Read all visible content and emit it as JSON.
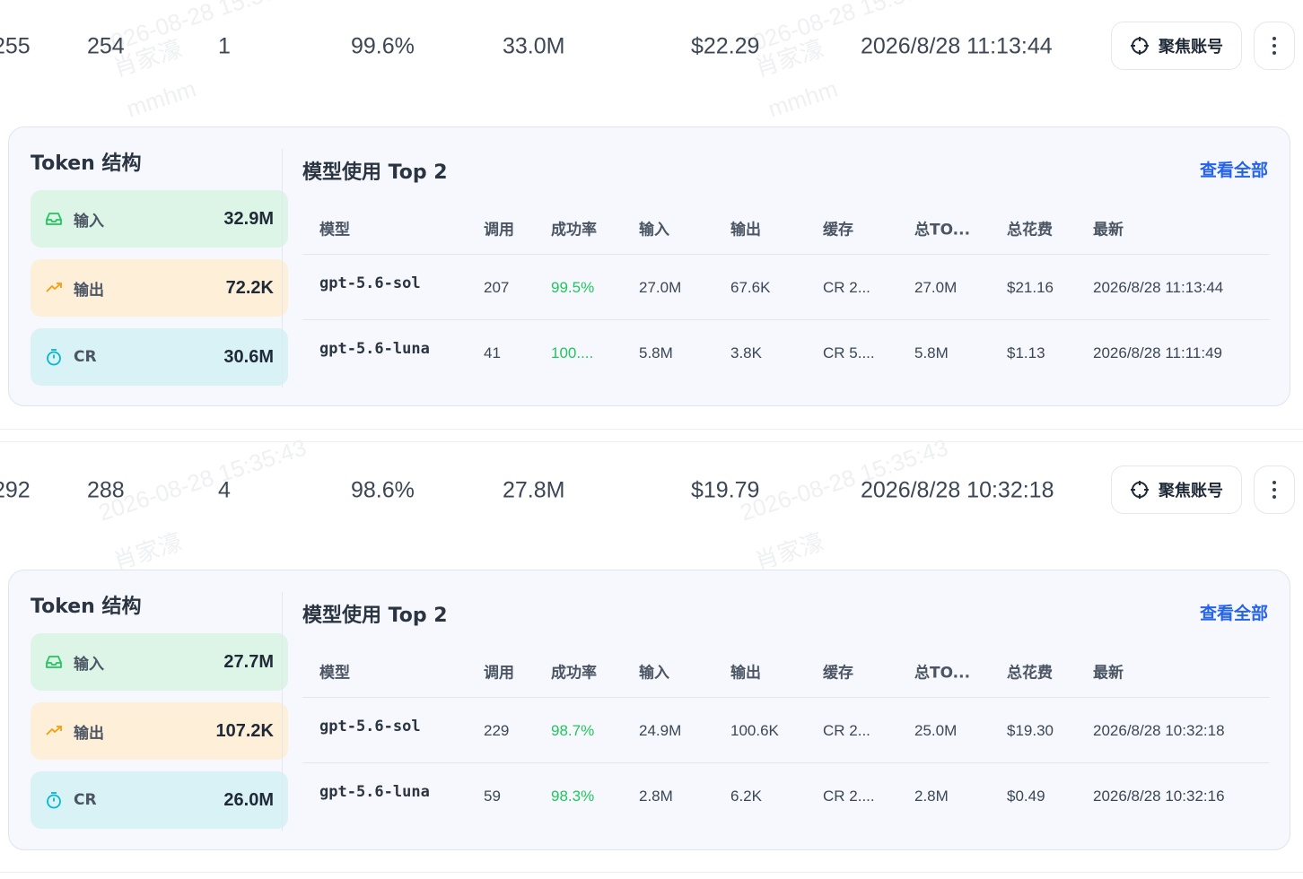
{
  "watermark": {
    "date": "2026-08-28 15:35:43",
    "name": "肖家濠",
    "user": "mmhm"
  },
  "colors": {
    "accent": "#2563eb",
    "success": "#22c55e",
    "input_bg": "#dcf5e6",
    "output_bg": "#fdefd8",
    "cr_bg": "#d9f2f6"
  },
  "labels": {
    "focus": "聚焦账号",
    "token_title": "Token 结构",
    "input": "输入",
    "output": "输出",
    "cr": "CR",
    "top_title": "模型使用 Top 2",
    "view_all": "查看全部",
    "columns": [
      "模型",
      "调用",
      "成功率",
      "输入",
      "输出",
      "缓存",
      "总TO...",
      "总花费",
      "最新"
    ]
  },
  "rows": [
    {
      "summary": {
        "total": "255",
        "success": "254",
        "failed": "1",
        "rate": "99.6%",
        "tokens": "33.0M",
        "cost": "$22.29",
        "latest": "2026/8/28 11:13:44"
      },
      "tokens": {
        "input": "32.9M",
        "output": "72.2K",
        "cr": "30.6M"
      },
      "models": [
        {
          "name": "gpt-5.6-sol",
          "calls": "207",
          "rate": "99.5%",
          "input": "27.0M",
          "output": "67.6K",
          "cache": "CR 2...",
          "total": "27.0M",
          "cost": "$21.16",
          "latest": "2026/8/28 11:13:44"
        },
        {
          "name": "gpt-5.6-luna",
          "calls": "41",
          "rate": "100....",
          "input": "5.8M",
          "output": "3.8K",
          "cache": "CR 5....",
          "total": "5.8M",
          "cost": "$1.13",
          "latest": "2026/8/28 11:11:49"
        }
      ]
    },
    {
      "summary": {
        "total": "292",
        "success": "288",
        "failed": "4",
        "rate": "98.6%",
        "tokens": "27.8M",
        "cost": "$19.79",
        "latest": "2026/8/28 10:32:18"
      },
      "tokens": {
        "input": "27.7M",
        "output": "107.2K",
        "cr": "26.0M"
      },
      "models": [
        {
          "name": "gpt-5.6-sol",
          "calls": "229",
          "rate": "98.7%",
          "input": "24.9M",
          "output": "100.6K",
          "cache": "CR 2...",
          "total": "25.0M",
          "cost": "$19.30",
          "latest": "2026/8/28 10:32:18"
        },
        {
          "name": "gpt-5.6-luna",
          "calls": "59",
          "rate": "98.3%",
          "input": "2.8M",
          "output": "6.2K",
          "cache": "CR 2....",
          "total": "2.8M",
          "cost": "$0.49",
          "latest": "2026/8/28 10:32:16"
        }
      ]
    }
  ]
}
